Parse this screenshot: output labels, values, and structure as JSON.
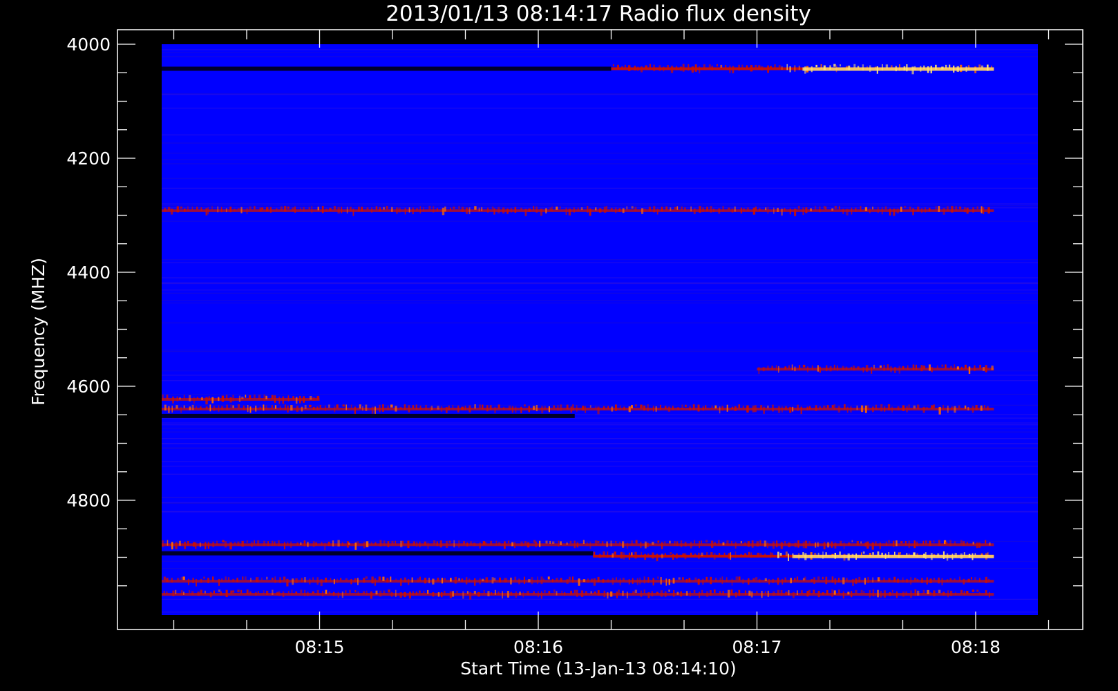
{
  "chart_data": {
    "type": "heatmap",
    "title": "2013/01/13 08:14:17 Radio flux density",
    "xlabel": "Start Time (13-Jan-13 08:14:10)",
    "ylabel": "Frequency (MHZ)",
    "x_ticks": [
      "08:15",
      "08:16",
      "08:17",
      "08:18"
    ],
    "y_ticks": [
      4000,
      4200,
      4400,
      4600,
      4800
    ],
    "y_range_mhz": [
      4000,
      5000
    ],
    "x_range_seconds_after_08:14:00": [
      4,
      245
    ],
    "background_color": "#0000ff",
    "colors": {
      "background": "#0000ff",
      "dark": "#00002a",
      "red": "#cc1100",
      "orange": "#ff6a00",
      "yellow": "#ffe070"
    },
    "bands": [
      {
        "freq_mhz": 4043,
        "kind": "dark",
        "from_s": 4,
        "to_s": 140
      },
      {
        "freq_mhz": 4043,
        "kind": "bright",
        "from_s": 140,
        "to_s": 245,
        "peak": "yellow"
      },
      {
        "freq_mhz": 4292,
        "kind": "red",
        "from_s": 4,
        "to_s": 245
      },
      {
        "freq_mhz": 4570,
        "kind": "red",
        "from_s": 180,
        "to_s": 245
      },
      {
        "freq_mhz": 4623,
        "kind": "red",
        "from_s": 4,
        "to_s": 60
      },
      {
        "freq_mhz": 4640,
        "kind": "red",
        "from_s": 4,
        "to_s": 245
      },
      {
        "freq_mhz": 4652,
        "kind": "dark",
        "from_s": 4,
        "to_s": 130
      },
      {
        "freq_mhz": 4878,
        "kind": "red",
        "from_s": 4,
        "to_s": 245
      },
      {
        "freq_mhz": 4893,
        "kind": "dark",
        "from_s": 4,
        "to_s": 135
      },
      {
        "freq_mhz": 4898,
        "kind": "bright",
        "from_s": 135,
        "to_s": 245,
        "peak": "yellow"
      },
      {
        "freq_mhz": 4942,
        "kind": "red",
        "from_s": 4,
        "to_s": 245
      },
      {
        "freq_mhz": 4965,
        "kind": "red",
        "from_s": 4,
        "to_s": 245
      }
    ]
  }
}
